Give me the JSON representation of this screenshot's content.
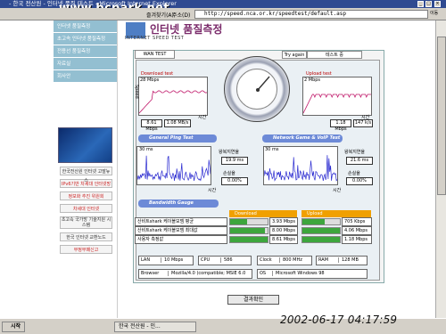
{
  "window": {
    "title": "- 한국 전산원 - 인터넷 품질 테스트 - Microsoft Internet Explorer",
    "watermark": "www.bcpark.net"
  },
  "toolbar": {
    "favorites": "즐겨찾기(A)",
    "address_label": "주소(D)",
    "address_value": "http://speed.nca.or.kr/speedtest/default.asp",
    "go": "이동"
  },
  "sidebar": {
    "items": [
      {
        "label": "인터넷 품질측정"
      },
      {
        "label": "초고속 인터넷 품질측정"
      },
      {
        "label": "전용선 품질측정"
      },
      {
        "label": "자료실"
      },
      {
        "label": "회사안"
      }
    ],
    "banners": [
      {
        "label": "한국전산원 인터넷 고발뉴스"
      },
      {
        "label": "IPv6기반 차세대 인터넷망"
      },
      {
        "label": "정보화 추진 위원회"
      },
      {
        "label": "차세대 인터넷"
      },
      {
        "label": "초고속 국가망 기술지원 시스템"
      },
      {
        "label": "한국 인터넷 교환노드"
      },
      {
        "label": "부정부패신고"
      }
    ]
  },
  "page": {
    "title": "인터넷 품질측정",
    "subtitle": "INTERNET SPEED TEST",
    "tab_wan": "WAN TEST",
    "try_again": "Try again",
    "test_label": "테스트 중",
    "confirm_button": "결과확인"
  },
  "download": {
    "title": "Download test",
    "peak": "28 Mbps",
    "axis_label": "시간",
    "y_label": "Speed",
    "speed_mbps": "8.61 Mbps",
    "speed_mbs": "1.08 MB/s"
  },
  "upload": {
    "title": "Upload test",
    "peak": "2 Mbps",
    "axis_label": "시간",
    "y_label": "Speed",
    "speed_mbps": "1.18 Mbps",
    "speed_kbs": "147 k/s"
  },
  "ping": {
    "section": "General Ping Test",
    "peak": "30 ms",
    "axis_label": "시간",
    "avg_label": "왕복지연율",
    "avg_value": "19.9 ms",
    "loss_label": "손실율",
    "loss_value": "0.00%"
  },
  "game": {
    "section": "Network Game & VoIP Test",
    "peak": "30 ms",
    "axis_label": "시간",
    "avg_label": "왕복지연율",
    "avg_value": "21.6 ms",
    "loss_label": "손실율",
    "loss_value": "0.00%"
  },
  "bandwidth": {
    "section": "Bandwidth Gauge",
    "download_header": "Download",
    "upload_header": "Upload",
    "rows": [
      {
        "label": "산비트shark 케이블모뎀 평균",
        "down": "3.93 Mbps",
        "down_pct": 46,
        "up": "705 Kbps",
        "up_pct": 60
      },
      {
        "label": "산비트shark 케이블모뎀 최대값",
        "down": "8.00 Mbps",
        "down_pct": 93,
        "up": "4.06 Mbps",
        "up_pct": 100
      },
      {
        "label": "사용자 측정값",
        "down": "8.61 Mbps",
        "down_pct": 100,
        "up": "1.18 Mbps",
        "up_pct": 100
      }
    ]
  },
  "system": {
    "lan_label": "LAN",
    "lan_value": "10 Mbps",
    "cpu_label": "CPU",
    "cpu_value": "586",
    "clock_label": "Clock",
    "clock_value": "800 MHz",
    "ram_label": "RAM",
    "ram_value": "128 MB",
    "browser_label": "Browser",
    "browser_value": "Mozilla/4.0 (compatible; MSIE 6.0",
    "os_label": "OS",
    "os_value": "Microsoft Windows 98"
  },
  "taskbar": {
    "start": "시작",
    "task": "한국 전산원 - 인...",
    "clock_overlay": "2002-06-17 04:17:59"
  },
  "colors": {
    "titlebar": "#2f4a91",
    "nav": "#93bfd1",
    "section": "#6d8ad7",
    "download_line": "#c0186a",
    "ping_line": "#2a2ad0",
    "bar_fill": "#3da63d",
    "bar_header": "#f0a000"
  }
}
